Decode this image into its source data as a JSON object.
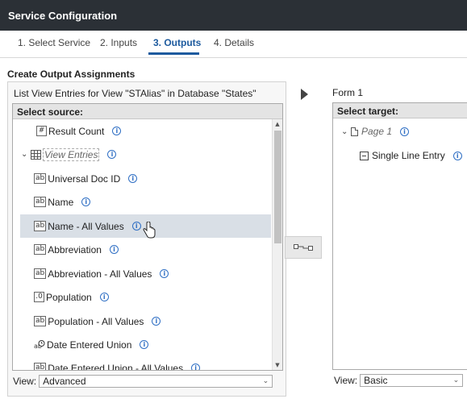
{
  "window": {
    "title": "Service Configuration"
  },
  "tabs": [
    {
      "label": "1. Select Service",
      "active": false
    },
    {
      "label": "2. Inputs",
      "active": false
    },
    {
      "label": "3. Outputs",
      "active": true
    },
    {
      "label": "4. Details",
      "active": false
    }
  ],
  "section_title": "Create Output Assignments",
  "source": {
    "caption": "List View Entries for View \"STAlias\" in Database \"States\"",
    "header": "Select source:",
    "items": [
      {
        "label": "Result Count",
        "type_icon": "#",
        "icon_name": "number-icon"
      },
      {
        "label": "View Entries",
        "type_icon": "grid",
        "icon_name": "grid-icon"
      },
      {
        "label": "Universal Doc ID",
        "type_icon": "ab",
        "icon_name": "text-field-icon"
      },
      {
        "label": "Name",
        "type_icon": "ab",
        "icon_name": "text-field-icon"
      },
      {
        "label": "Name - All Values",
        "type_icon": "ab",
        "icon_name": "text-field-icon",
        "selected": true
      },
      {
        "label": "Abbreviation",
        "type_icon": "ab",
        "icon_name": "text-field-icon"
      },
      {
        "label": "Abbreviation - All Values",
        "type_icon": "ab",
        "icon_name": "text-field-icon"
      },
      {
        "label": "Population",
        "type_icon": ".0",
        "icon_name": "number-field-icon"
      },
      {
        "label": "Population - All Values",
        "type_icon": "ab",
        "icon_name": "text-field-icon"
      },
      {
        "label": "Date Entered Union",
        "type_icon": "date",
        "icon_name": "date-field-icon"
      },
      {
        "label": "Date Entered Union - All Values",
        "type_icon": "ab",
        "icon_name": "text-field-icon"
      }
    ],
    "view_label": "View:",
    "view_value": "Advanced"
  },
  "target": {
    "caption": "Form 1",
    "header": "Select target:",
    "page_label": "Page 1",
    "field_label": "Single Line Entry",
    "view_label": "View:",
    "view_value": "Basic"
  },
  "colors": {
    "titlebar": "#2b3036",
    "accent": "#1d5a9e",
    "selection": "#d9dfe6",
    "info": "#2f6fc4"
  }
}
